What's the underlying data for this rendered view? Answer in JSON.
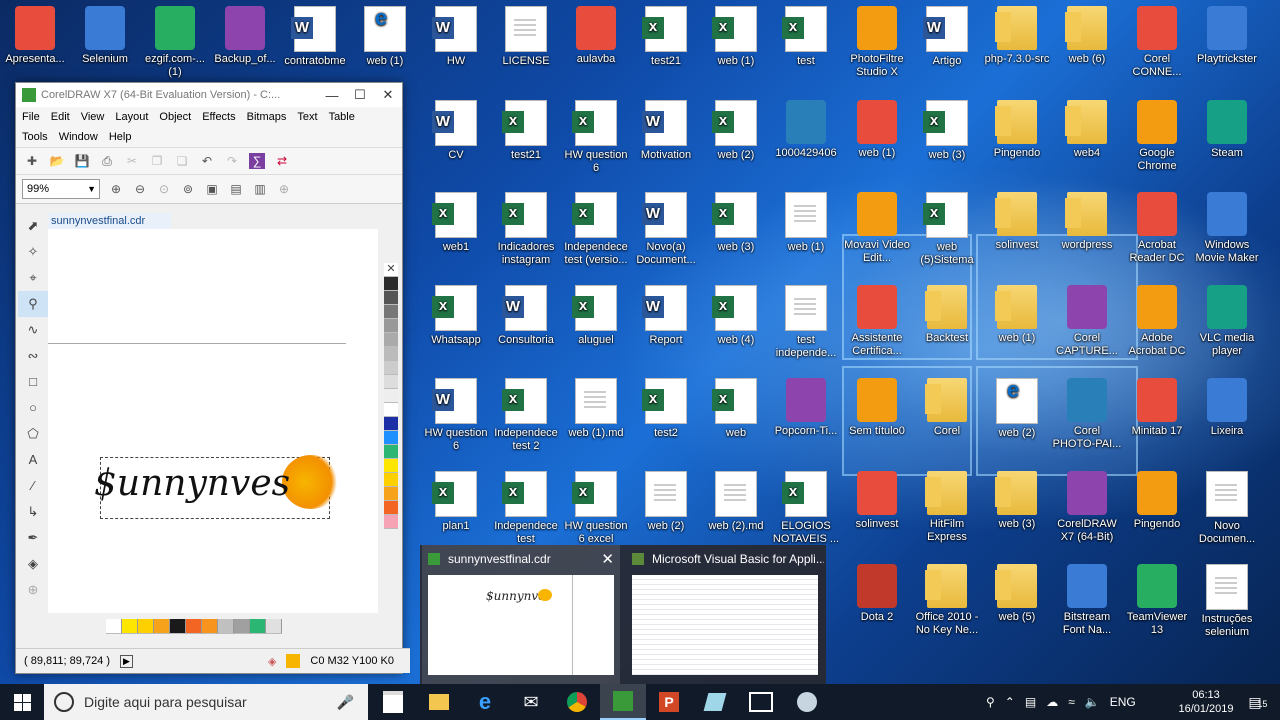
{
  "desktop": {
    "icons": [
      {
        "label": "Apresenta...",
        "type": "app"
      },
      {
        "label": "Selenium",
        "type": "app"
      },
      {
        "label": "ezgif.com-... (1)",
        "type": "app"
      },
      {
        "label": "Backup_of...",
        "type": "app"
      },
      {
        "label": "contratobme",
        "type": "word"
      },
      {
        "label": "web (1)",
        "type": "pdf"
      },
      {
        "label": "HW",
        "type": "word"
      },
      {
        "label": "LICENSE",
        "type": "doc"
      },
      {
        "label": "aulavba",
        "type": "app"
      },
      {
        "label": "test21",
        "type": "excel"
      },
      {
        "label": "web (1)",
        "type": "excel"
      },
      {
        "label": "test",
        "type": "excel"
      },
      {
        "label": "PhotoFiltre Studio X",
        "type": "app"
      },
      {
        "label": "Artigo",
        "type": "word"
      },
      {
        "label": "php-7.3.0-src",
        "type": "folder"
      },
      {
        "label": "web (6)",
        "type": "folder"
      },
      {
        "label": "Corel CONNE...",
        "type": "app"
      },
      {
        "label": "Playtrickster",
        "type": "app"
      },
      {
        "label": "CV",
        "type": "word"
      },
      {
        "label": "test21",
        "type": "excel"
      },
      {
        "label": "HW question 6",
        "type": "excel"
      },
      {
        "label": "Motivation",
        "type": "word"
      },
      {
        "label": "web (2)",
        "type": "excel"
      },
      {
        "label": "1000429406",
        "type": "app"
      },
      {
        "label": "web (1)",
        "type": "app"
      },
      {
        "label": "web (3)",
        "type": "excel"
      },
      {
        "label": "Pingendo",
        "type": "folder"
      },
      {
        "label": "web4",
        "type": "folder"
      },
      {
        "label": "Google Chrome",
        "type": "app"
      },
      {
        "label": "Steam",
        "type": "app"
      },
      {
        "label": "web1",
        "type": "excel"
      },
      {
        "label": "Indicadores instagram",
        "type": "excel"
      },
      {
        "label": "Independece test (versio...",
        "type": "excel"
      },
      {
        "label": "Novo(a) Document...",
        "type": "word"
      },
      {
        "label": "web (3)",
        "type": "excel"
      },
      {
        "label": "web (1)",
        "type": "doc"
      },
      {
        "label": "Movavi Video Edit...",
        "type": "app"
      },
      {
        "label": "web (5)Sistema",
        "type": "excel"
      },
      {
        "label": "solinvest",
        "type": "folder"
      },
      {
        "label": "wordpress",
        "type": "folder"
      },
      {
        "label": "Acrobat Reader DC",
        "type": "app"
      },
      {
        "label": "Windows Movie Maker",
        "type": "app"
      },
      {
        "label": "Whatsapp",
        "type": "excel"
      },
      {
        "label": "Consultoria",
        "type": "word"
      },
      {
        "label": "aluguel",
        "type": "excel"
      },
      {
        "label": "Report",
        "type": "word"
      },
      {
        "label": "web (4)",
        "type": "excel"
      },
      {
        "label": "test independe...",
        "type": "doc"
      },
      {
        "label": "Assistente Certifica...",
        "type": "app"
      },
      {
        "label": "Backtest",
        "type": "folder"
      },
      {
        "label": "web (1)",
        "type": "folder"
      },
      {
        "label": "Corel CAPTURE...",
        "type": "app"
      },
      {
        "label": "Adobe Acrobat DC",
        "type": "app"
      },
      {
        "label": "VLC media player",
        "type": "app"
      },
      {
        "label": "HW question 6",
        "type": "word"
      },
      {
        "label": "Independece test 2",
        "type": "excel"
      },
      {
        "label": "web (1).md",
        "type": "doc"
      },
      {
        "label": "test2",
        "type": "excel"
      },
      {
        "label": "web",
        "type": "excel"
      },
      {
        "label": "Popcorn-Ti...",
        "type": "app"
      },
      {
        "label": "Sem título0",
        "type": "app"
      },
      {
        "label": "Corel",
        "type": "folder"
      },
      {
        "label": "web (2)",
        "type": "pdf"
      },
      {
        "label": "Corel PHOTO-PAI...",
        "type": "app"
      },
      {
        "label": "Minitab 17",
        "type": "app"
      },
      {
        "label": "Lixeira",
        "type": "app"
      },
      {
        "label": "plan1",
        "type": "excel"
      },
      {
        "label": "Independece test",
        "type": "excel"
      },
      {
        "label": "HW question 6 excel",
        "type": "excel"
      },
      {
        "label": "web (2)",
        "type": "doc"
      },
      {
        "label": "web (2).md",
        "type": "doc"
      },
      {
        "label": "ELOGIOS NOTAVEIS ...",
        "type": "excel"
      },
      {
        "label": "solinvest",
        "type": "app"
      },
      {
        "label": "HitFilm Express",
        "type": "folder"
      },
      {
        "label": "web (3)",
        "type": "folder"
      },
      {
        "label": "CorelDRAW X7 (64-Bit)",
        "type": "app"
      },
      {
        "label": "Pingendo",
        "type": "app"
      },
      {
        "label": "Novo Documen...",
        "type": "doc"
      },
      {
        "label": "Dota 2",
        "type": "app"
      },
      {
        "label": "Office 2010 - No Key Ne...",
        "type": "folder"
      },
      {
        "label": "web (5)",
        "type": "folder"
      },
      {
        "label": "Bitstream Font Na...",
        "type": "app"
      },
      {
        "label": "TeamViewer 13",
        "type": "app"
      },
      {
        "label": "Instruções selenium",
        "type": "doc"
      }
    ]
  },
  "coreldraw": {
    "title": "CorelDRAW X7 (64-Bit Evaluation Version) - C:...",
    "menu": [
      "File",
      "Edit",
      "View",
      "Layout",
      "Object",
      "Effects",
      "Bitmaps",
      "Text",
      "Table",
      "Tools",
      "Window",
      "Help"
    ],
    "zoom": "99%",
    "doc_tab": "sunnynvestfinal.cdr",
    "artwork_text": "$unnynves",
    "coords": "( 89,811; 89,724 )",
    "fill_status": "C0 M32 Y100 K0",
    "fill_color": "#f7b500",
    "palette_v": [
      "#2b2b2b",
      "#555555",
      "#777777",
      "#999999",
      "#aaaaaa",
      "#bbbbbb",
      "#cccccc",
      "#dddddd",
      "#eeeeee",
      "#ffffff",
      "#1c2fa6",
      "#1e90ff",
      "#2bb673",
      "#ffe600",
      "#ffd000",
      "#f7a21b",
      "#f26522",
      "#f5a3b5"
    ],
    "palette_h": [
      "#ffffff",
      "#ffe600",
      "#ffd000",
      "#f7a21b",
      "#1a1a1a",
      "#f26522",
      "#f7941d",
      "#c0c0c0",
      "#a0a0a0",
      "#2bb673",
      "#e0e0e0"
    ]
  },
  "taskbar": {
    "search_placeholder": "Digite aqui para pesquisar",
    "language": "ENG",
    "time": "06:13",
    "date": "16/01/2019",
    "notifications": "15"
  },
  "thumbnails": [
    {
      "title": "sunnynvestfinal.cdr"
    },
    {
      "title": "Microsoft Visual Basic for Appli..."
    }
  ]
}
